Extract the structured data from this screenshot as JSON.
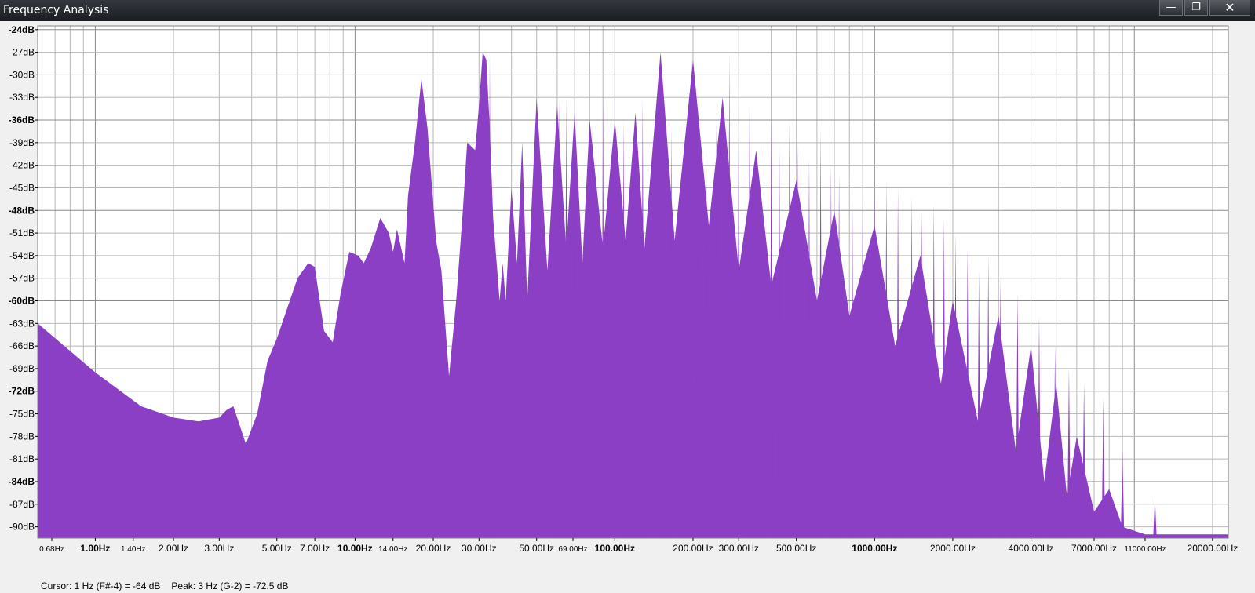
{
  "window": {
    "title": "Frequency Analysis",
    "minimize_glyph": "—",
    "maximize_glyph": "❐",
    "close_glyph": "✕"
  },
  "status": {
    "cursor": "Cursor: 1 Hz (F#-4) = -64 dB",
    "peak": "Peak: 3 Hz (G-2) = -72.5 dB"
  },
  "colors": {
    "fill": "#8a3fc5",
    "grid": "#b8b8b8",
    "plot_bg": "#ffffff"
  },
  "chart_data": {
    "type": "area",
    "x_scale": "log",
    "xlim": [
      0.6,
      23000
    ],
    "ylim": [
      -91.5,
      -23.5
    ],
    "grid": true,
    "y_ticks": [
      -24,
      -27,
      -30,
      -33,
      -36,
      -39,
      -42,
      -45,
      -48,
      -51,
      -54,
      -57,
      -60,
      -63,
      -66,
      -69,
      -72,
      -75,
      -78,
      -81,
      -84,
      -87,
      -90
    ],
    "y_tick_labels": [
      "-24dB",
      "-27dB",
      "-30dB",
      "-33dB",
      "-36dB",
      "-39dB",
      "-42dB",
      "-45dB",
      "-48dB",
      "-51dB",
      "-54dB",
      "-57dB",
      "-60dB",
      "-63dB",
      "-66dB",
      "-69dB",
      "-72dB",
      "-75dB",
      "-78dB",
      "-81dB",
      "-84dB",
      "-87dB",
      "-90dB"
    ],
    "x_ticks": [
      {
        "value": 0.68,
        "label": "0.68Hz",
        "bold": false,
        "small": true
      },
      {
        "value": 1,
        "label": "1.00Hz",
        "bold": true,
        "small": false
      },
      {
        "value": 1.4,
        "label": "1.40Hz",
        "bold": false,
        "small": true
      },
      {
        "value": 2,
        "label": "2.00Hz",
        "bold": false,
        "small": false
      },
      {
        "value": 3,
        "label": "3.00Hz",
        "bold": false,
        "small": false
      },
      {
        "value": 5,
        "label": "5.00Hz",
        "bold": false,
        "small": false
      },
      {
        "value": 7,
        "label": "7.00Hz",
        "bold": false,
        "small": false
      },
      {
        "value": 10,
        "label": "10.00Hz",
        "bold": true,
        "small": false
      },
      {
        "value": 14,
        "label": "14.00Hz",
        "bold": false,
        "small": true
      },
      {
        "value": 20,
        "label": "20.00Hz",
        "bold": false,
        "small": false
      },
      {
        "value": 30,
        "label": "30.00Hz",
        "bold": false,
        "small": false
      },
      {
        "value": 50,
        "label": "50.00Hz",
        "bold": false,
        "small": false
      },
      {
        "value": 69,
        "label": "69.00Hz",
        "bold": false,
        "small": true
      },
      {
        "value": 100,
        "label": "100.00Hz",
        "bold": true,
        "small": false
      },
      {
        "value": 200,
        "label": "200.00Hz",
        "bold": false,
        "small": false
      },
      {
        "value": 300,
        "label": "300.00Hz",
        "bold": false,
        "small": false
      },
      {
        "value": 500,
        "label": "500.00Hz",
        "bold": false,
        "small": false
      },
      {
        "value": 1000,
        "label": "1000.00Hz",
        "bold": true,
        "small": false
      },
      {
        "value": 2000,
        "label": "2000.00Hz",
        "bold": false,
        "small": false
      },
      {
        "value": 4000,
        "label": "4000.00Hz",
        "bold": false,
        "small": false
      },
      {
        "value": 7000,
        "label": "7000.00Hz",
        "bold": false,
        "small": false
      },
      {
        "value": 11000,
        "label": "11000.00Hz",
        "bold": false,
        "small": true
      },
      {
        "value": 20000,
        "label": "20000.00Hz",
        "bold": false,
        "small": false
      }
    ],
    "x": [
      0.6,
      1,
      1.5,
      2,
      2.5,
      3,
      3.2,
      3.4,
      3.8,
      4.2,
      4.6,
      5.0,
      6.0,
      6.6,
      7.0,
      7.6,
      8.2,
      8.8,
      9.5,
      10.3,
      10.8,
      11.5,
      12.5,
      13.5,
      14,
      14.5,
      15.5,
      16,
      17,
      18,
      19,
      20.5,
      21.5,
      23,
      24.5,
      26,
      27,
      29,
      30,
      31,
      32,
      33,
      34,
      36,
      37,
      38,
      40,
      42,
      44,
      46,
      50,
      55,
      60,
      65,
      70,
      75,
      80,
      90,
      100,
      110,
      120,
      130,
      150,
      170,
      200,
      230,
      260,
      300,
      350,
      400,
      500,
      600,
      700,
      800,
      1000,
      1200,
      1500,
      1800,
      2000,
      2500,
      3000,
      3500,
      4000,
      4500,
      5000,
      5500,
      6000,
      7000,
      8000,
      9000,
      11000,
      14000,
      17000,
      23000
    ],
    "y": [
      -63,
      -69.5,
      -74,
      -75.5,
      -76,
      -75.5,
      -74.5,
      -74,
      -79,
      -75,
      -68,
      -65,
      -57,
      -55,
      -55.5,
      -64,
      -65.5,
      -59,
      -53.5,
      -54,
      -55,
      -53,
      -49,
      -51,
      -53.5,
      -50.5,
      -55,
      -46,
      -39,
      -30.5,
      -37,
      -52,
      -56,
      -70,
      -60,
      -48,
      -39,
      -40,
      -34,
      -27,
      -28,
      -37,
      -49,
      -60,
      -55,
      -60,
      -45,
      -55,
      -39,
      -60,
      -33,
      -56,
      -34,
      -53,
      -35,
      -55,
      -36,
      -53,
      -36,
      -52,
      -35,
      -53,
      -27,
      -52,
      -28,
      -50,
      -33,
      -56,
      -40,
      -58,
      -44,
      -60,
      -48,
      -62,
      -50,
      -66,
      -54,
      -71,
      -60,
      -76,
      -62,
      -80,
      -66,
      -84,
      -71,
      -86,
      -78,
      -88,
      -85,
      -90,
      -91,
      -91,
      -91,
      -91
    ],
    "spikes": [
      {
        "x": 33,
        "y": -27
      },
      {
        "x": 61,
        "y": -33
      },
      {
        "x": 65,
        "y": -33
      },
      {
        "x": 70,
        "y": -36
      },
      {
        "x": 82,
        "y": -37
      },
      {
        "x": 90,
        "y": -33
      },
      {
        "x": 108,
        "y": -36
      },
      {
        "x": 120,
        "y": -35
      },
      {
        "x": 128,
        "y": -33
      },
      {
        "x": 150,
        "y": -32
      },
      {
        "x": 165,
        "y": -37
      },
      {
        "x": 185,
        "y": -36
      },
      {
        "x": 198,
        "y": -27
      },
      {
        "x": 208,
        "y": -43
      },
      {
        "x": 225,
        "y": -40
      },
      {
        "x": 246,
        "y": -36
      },
      {
        "x": 276,
        "y": -27
      },
      {
        "x": 300,
        "y": -31
      },
      {
        "x": 330,
        "y": -34
      },
      {
        "x": 365,
        "y": -39
      },
      {
        "x": 400,
        "y": -36
      },
      {
        "x": 430,
        "y": -39
      },
      {
        "x": 470,
        "y": -36
      },
      {
        "x": 505,
        "y": -39
      },
      {
        "x": 560,
        "y": -41
      },
      {
        "x": 620,
        "y": -37
      },
      {
        "x": 680,
        "y": -42
      },
      {
        "x": 730,
        "y": -43
      },
      {
        "x": 820,
        "y": -42
      },
      {
        "x": 900,
        "y": -44
      },
      {
        "x": 1000,
        "y": -45
      },
      {
        "x": 1110,
        "y": -44
      },
      {
        "x": 1230,
        "y": -45
      },
      {
        "x": 1390,
        "y": -46
      },
      {
        "x": 1520,
        "y": -48
      },
      {
        "x": 1690,
        "y": -47
      },
      {
        "x": 1850,
        "y": -49
      },
      {
        "x": 2050,
        "y": -51
      },
      {
        "x": 2280,
        "y": -53
      },
      {
        "x": 2520,
        "y": -56
      },
      {
        "x": 2740,
        "y": -54
      },
      {
        "x": 3050,
        "y": -57
      },
      {
        "x": 3550,
        "y": -59
      },
      {
        "x": 4300,
        "y": -62
      },
      {
        "x": 4950,
        "y": -66
      },
      {
        "x": 5600,
        "y": -69
      },
      {
        "x": 6400,
        "y": -71
      },
      {
        "x": 7600,
        "y": -73
      },
      {
        "x": 9000,
        "y": -80
      },
      {
        "x": 12000,
        "y": -86
      }
    ]
  }
}
